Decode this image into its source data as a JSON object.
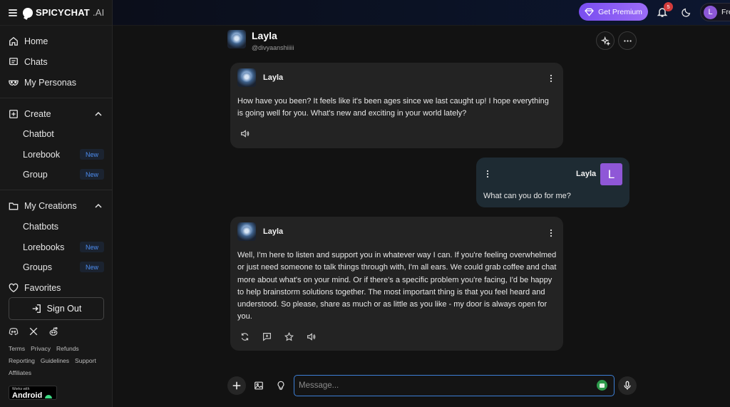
{
  "brand": {
    "name": "SPICYCHAT",
    "suffix": ".AI"
  },
  "sidebar": {
    "home": "Home",
    "chats": "Chats",
    "personas": "My Personas",
    "create": {
      "label": "Create",
      "items": [
        {
          "label": "Chatbot",
          "badge": ""
        },
        {
          "label": "Lorebook",
          "badge": "New"
        },
        {
          "label": "Group",
          "badge": "New"
        }
      ]
    },
    "creations": {
      "label": "My Creations",
      "items": [
        {
          "label": "Chatbots",
          "badge": ""
        },
        {
          "label": "Lorebooks",
          "badge": "New"
        },
        {
          "label": "Groups",
          "badge": "New"
        }
      ]
    },
    "favorites": "Favorites",
    "signout": "Sign Out",
    "footer_row1": [
      "Terms",
      "Privacy",
      "Refunds"
    ],
    "footer_row2": [
      "Reporting",
      "Guidelines",
      "Support"
    ],
    "footer_row3": [
      "Affiliates"
    ],
    "android_small": "Works with",
    "android_big": "Android"
  },
  "topbar": {
    "premium": "Get Premium",
    "notification_count": "5",
    "user_initial": "L",
    "user_text": "Fre"
  },
  "chat": {
    "bot_name": "Layla",
    "bot_handle": "@divyaanshiiiii",
    "messages": [
      {
        "author": "Layla",
        "text": "How have you been? It feels like it's been ages since we last caught up! I hope everything is going well for you. What's new and exciting in your world lately?"
      },
      {
        "author": "Layla",
        "initial": "L",
        "text": "What can you do for me?"
      },
      {
        "author": "Layla",
        "text": "Well, I'm here to listen and support you in whatever way I can. If you're feeling overwhelmed or just need someone to talk things through with, I'm all ears. We could grab coffee and chat more about what's on your mind. Or if there's a specific problem you're facing, I'd be happy to help brainstorm solutions together. The most important thing is that you feel heard and understood. So please, share as much or as little as you like - my door is always open for you."
      }
    ]
  },
  "composer": {
    "placeholder": "Message..."
  },
  "colors": {
    "accent": "#8c57d6",
    "new_badge": "#4d8df0",
    "input_border": "#3d7fd6"
  }
}
